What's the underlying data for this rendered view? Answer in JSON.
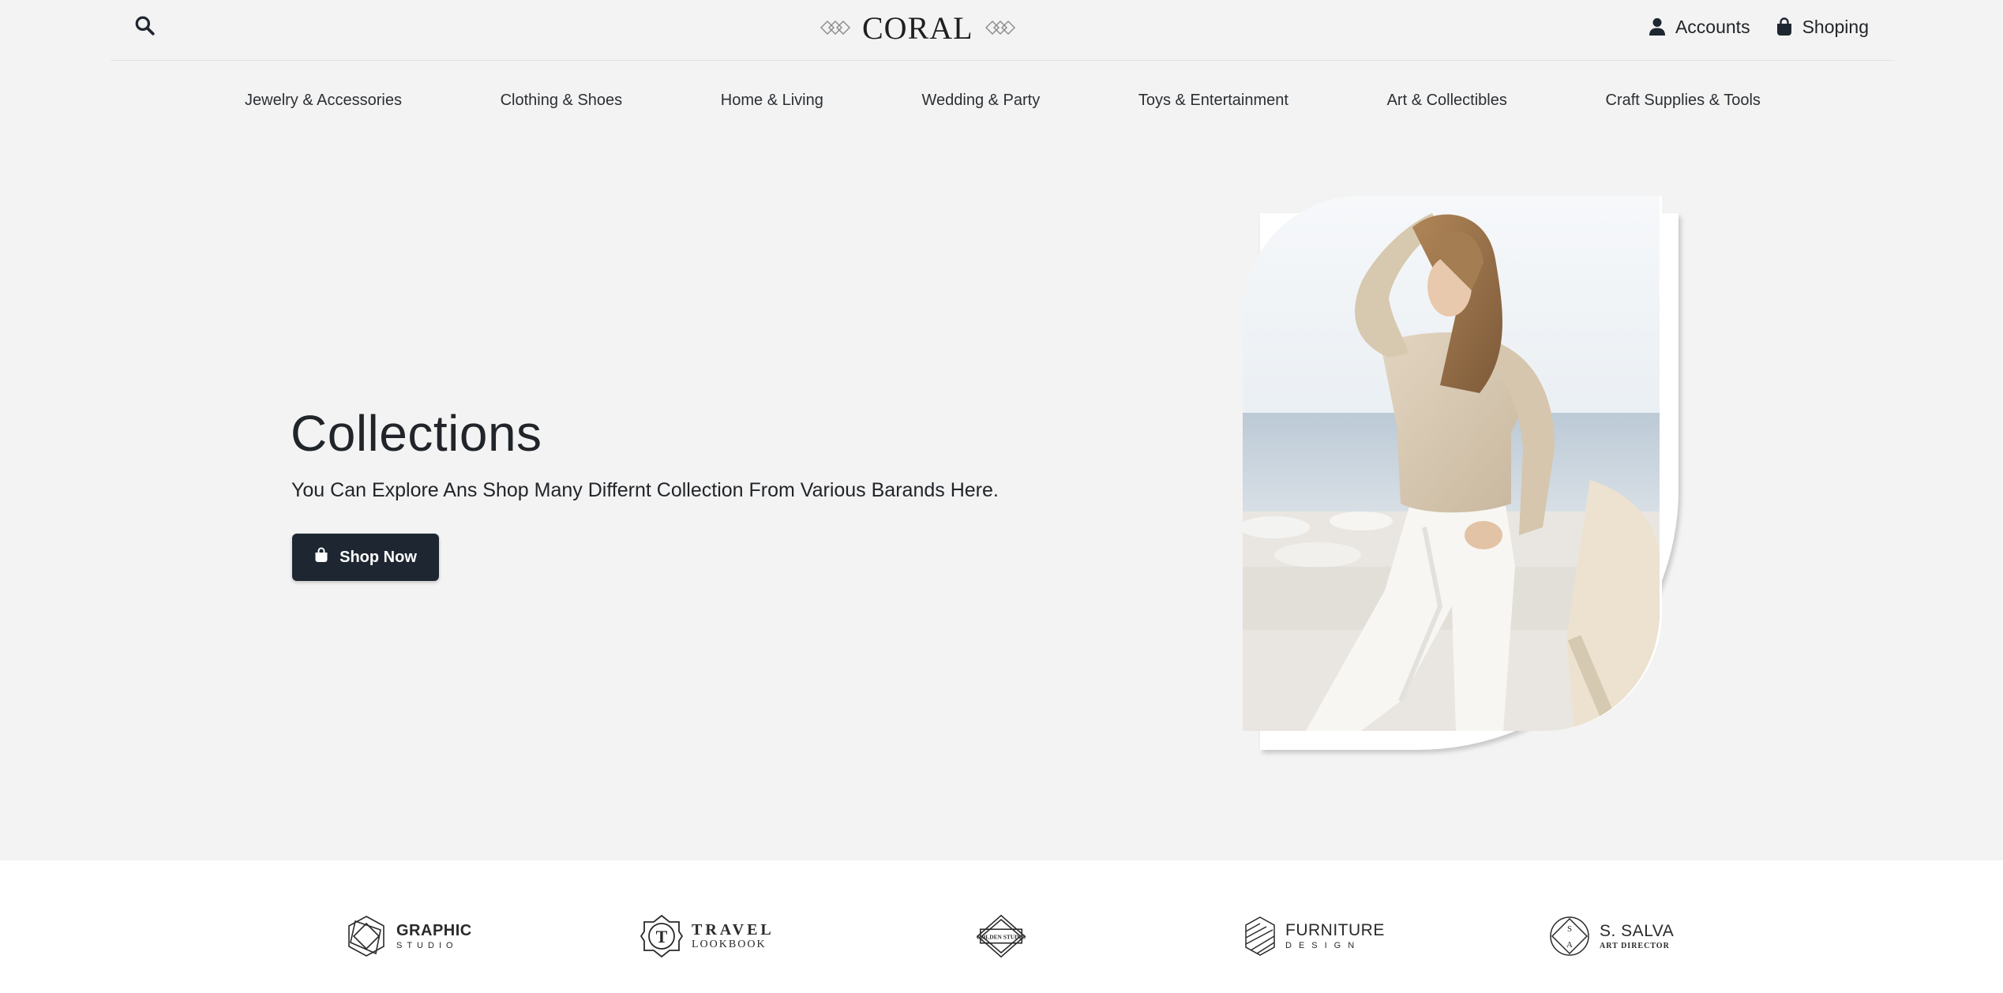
{
  "header": {
    "logo_text": "CORAL",
    "accounts_label": "Accounts",
    "shopping_label": "Shoping"
  },
  "nav": {
    "items": [
      "Jewelry & Accessories",
      "Clothing & Shoes",
      "Home & Living",
      "Wedding & Party",
      "Toys & Entertainment",
      "Art & Collectibles",
      "Craft Supplies & Tools"
    ]
  },
  "hero": {
    "title": "Collections",
    "subtitle": "You Can Explore Ans Shop Many Differnt Collection From Various Barands Here.",
    "button_label": "Shop Now"
  },
  "brands": [
    {
      "title": "GRAPHIC",
      "subtitle": "STUDIO",
      "icon": "hexagon-logo-icon"
    },
    {
      "title": "TRAVEL",
      "subtitle": "LOOKBOOK",
      "icon": "t-badge-logo-icon"
    },
    {
      "title": "GOLDEN STUDIO",
      "subtitle": "",
      "icon": "octagon-logo-icon"
    },
    {
      "title": "FURNITURE",
      "subtitle": "DESIGN",
      "icon": "cube-lines-logo-icon"
    },
    {
      "title": "S. SALVA",
      "subtitle": "ART DIRECTOR",
      "icon": "sa-diamond-logo-icon"
    }
  ],
  "colors": {
    "background": "#f3f3f3",
    "button": "#1e2731",
    "text": "#212529",
    "brand_strip": "#ffffff"
  }
}
